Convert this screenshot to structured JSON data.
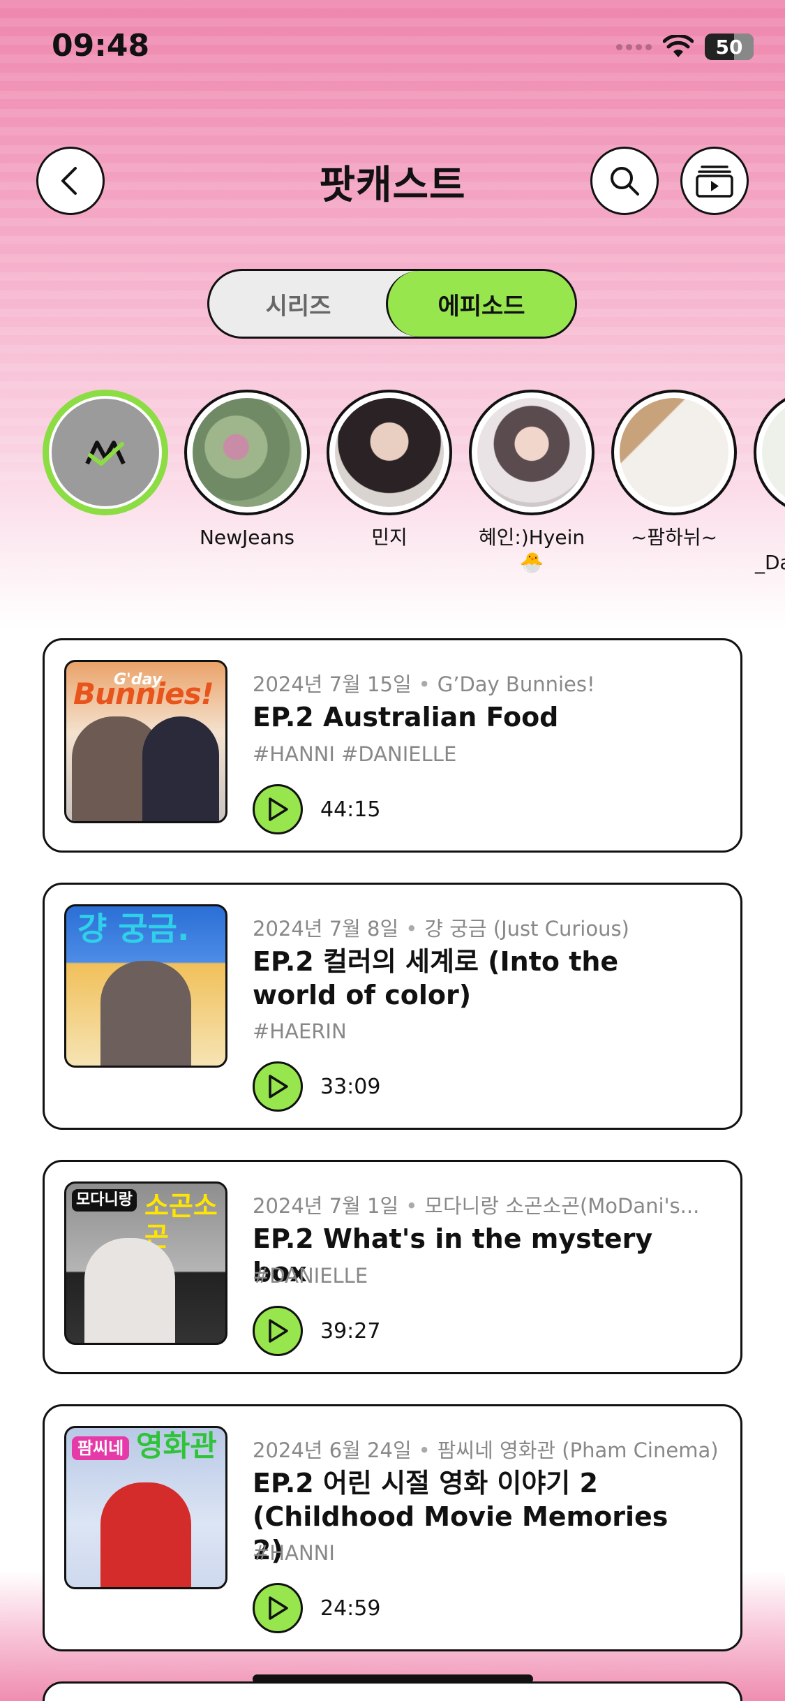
{
  "status_bar": {
    "time": "09:48",
    "battery": "50"
  },
  "header": {
    "title": "팟캐스트"
  },
  "segmented": {
    "series_label": "시리즈",
    "episode_label": "에피소드",
    "selected": "episode"
  },
  "artists": [
    {
      "name": "",
      "icon": "all-artists-logo",
      "active": true
    },
    {
      "name": "NewJeans"
    },
    {
      "name": "민지"
    },
    {
      "name": "혜인:)Hyein",
      "name_line2": "🐣"
    },
    {
      "name": "~팜하뉘~"
    },
    {
      "name": "_Da"
    }
  ],
  "episodes": [
    {
      "date": "2024년 7월 15일",
      "series": "G’Day Bunnies!",
      "title": "EP.2 Australian Food",
      "hashtags": "#HANNI #DANIELLE",
      "duration": "44:15",
      "thumb_text": "Bunnies!",
      "thumb_top_text": "G'day"
    },
    {
      "date": "2024년 7월 8일",
      "series": "걍 궁금 (Just Curious)",
      "title": "EP.2 컬러의 세계로 (Into the world of color)",
      "hashtags": "#HAERIN",
      "duration": "33:09",
      "thumb_text": "걍 궁금."
    },
    {
      "date": "2024년 7월 1일",
      "series": "모다니랑 소곤소곤(MoDani's...",
      "title": "EP.2 What's in the mystery box",
      "hashtags": "#DANIELLE",
      "duration": "39:27",
      "thumb_label": "모다니랑",
      "thumb_text": "소곤소곤"
    },
    {
      "date": "2024년 6월 24일",
      "series": "팜씨네 영화관 (Pham Cinema)",
      "title": "EP.2 어린 시절 영화 이야기 2 (Childhood Movie Memories 2)",
      "hashtags": "#HANNI",
      "duration": "24:59",
      "thumb_label": "팜씨네",
      "thumb_text": "영화관"
    }
  ],
  "colors": {
    "accent_green": "#97e64d",
    "pink_top": "#ee86ad"
  }
}
